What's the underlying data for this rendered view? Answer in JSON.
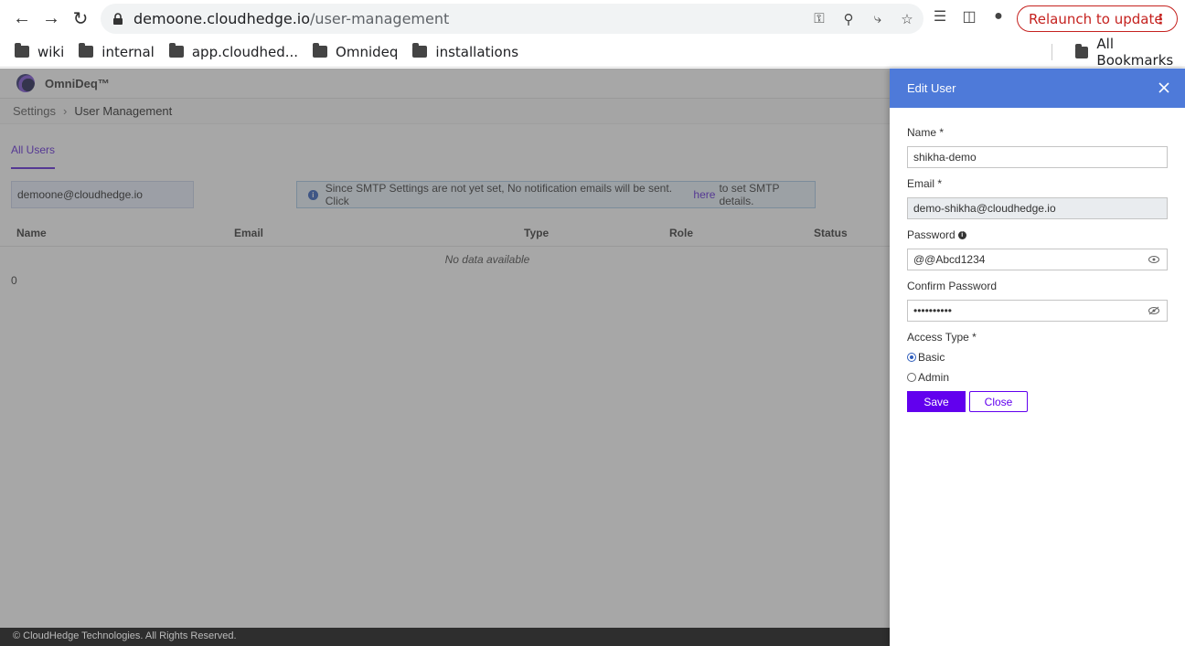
{
  "browser": {
    "url_host": "demoone.cloudhedge.io",
    "url_path": "/user-management",
    "relaunch_label": "Relaunch to update",
    "bookmarks": [
      "wiki",
      "internal",
      "app.cloudhed...",
      "Omnideq",
      "installations"
    ],
    "all_bookmarks": "All Bookmarks"
  },
  "app": {
    "brand": "OmniDeq™",
    "breadcrumb": {
      "parent": "Settings",
      "current": "User Management"
    },
    "tab_all_users": "All Users",
    "search_value": "demoone@cloudhedge.io",
    "smtp_banner": {
      "before": "Since SMTP Settings are not yet set, No notification emails will be sent. Click",
      "link": "here",
      "after": "to set SMTP details."
    },
    "table_headers": [
      "Name",
      "Email",
      "Type",
      "Role",
      "Status"
    ],
    "no_data": "No data available",
    "count": "0",
    "footer": "© CloudHedge Technologies. All Rights Reserved."
  },
  "drawer": {
    "title": "Edit User",
    "name_label": "Name *",
    "name_value": "shikha-demo",
    "email_label": "Email *",
    "email_value": "demo-shikha@cloudhedge.io",
    "password_label": "Password",
    "password_value": "@@Abcd1234",
    "confirm_label": "Confirm Password",
    "confirm_value": "••••••••••",
    "access_label": "Access Type *",
    "access_options": [
      "Basic",
      "Admin"
    ],
    "access_selected": "Basic",
    "save_label": "Save",
    "close_label": "Close"
  },
  "colors": {
    "accent": "#6200ee",
    "drawer_header": "#4e7ad9",
    "relaunch": "#c5221f"
  }
}
